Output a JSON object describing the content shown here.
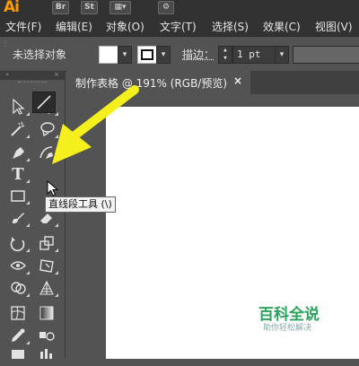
{
  "app_bar": {
    "logo": "Ai",
    "icons": [
      {
        "label": "Br"
      },
      {
        "label": "St"
      }
    ]
  },
  "menu": {
    "items": [
      "文件(F)",
      "编辑(E)",
      "对象(O)",
      "文字(T)",
      "选择(S)",
      "效果(C)",
      "视图(V)"
    ]
  },
  "control_bar": {
    "selection_status": "未选择对象",
    "stroke_label": "描边：",
    "stroke_value": "1 pt"
  },
  "document_tab": {
    "title": "制作表格 @ 191% (RGB/预览)",
    "close": "×"
  },
  "tools_panel": {
    "tooltip": "直线段工具 (\\)",
    "active_tool": "line-segment-tool"
  },
  "watermark": {
    "title": "百科全说",
    "subtitle": "助你轻松解决"
  },
  "colors": {
    "app_bar": "#323232",
    "panel": "#535353",
    "logo": "#ff9a00",
    "arrow": "#f5ef1e",
    "artboard": "#ffffff"
  }
}
